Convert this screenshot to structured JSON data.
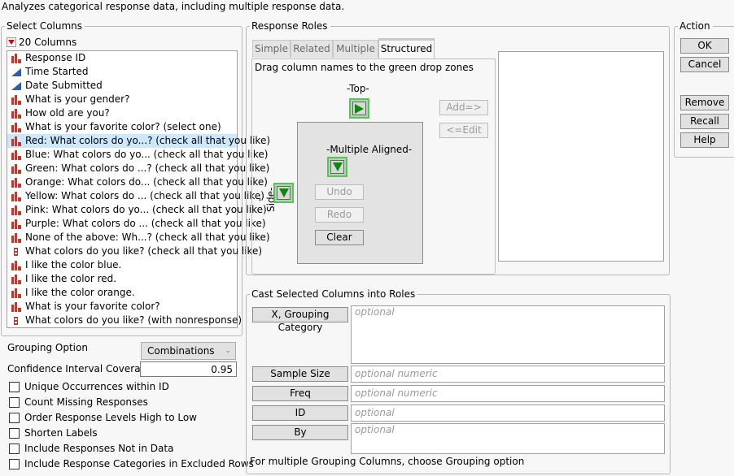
{
  "description": "Analyzes categorical response data, including multiple response data.",
  "select_columns": {
    "title": "Select Columns",
    "count_label": "20 Columns",
    "columns": [
      {
        "label": "Response ID",
        "type": "nominal"
      },
      {
        "label": "Time Started",
        "type": "continuous"
      },
      {
        "label": "Date Submitted",
        "type": "continuous"
      },
      {
        "label": "What is your gender?",
        "type": "nominal"
      },
      {
        "label": "How old are you?",
        "type": "nominal"
      },
      {
        "label": "What is your favorite color? (select one)",
        "type": "nominal"
      },
      {
        "label": "Red: What colors do yo...? (check all that you like)",
        "type": "nominal",
        "selected": true
      },
      {
        "label": "Blue: What colors do yo... (check all that you like)",
        "type": "nominal"
      },
      {
        "label": "Green: What colors do ...? (check all that you like)",
        "type": "nominal"
      },
      {
        "label": "Orange: What colors do... (check all that you like)",
        "type": "nominal"
      },
      {
        "label": "Yellow: What colors do ... (check all that you like)",
        "type": "nominal"
      },
      {
        "label": "Pink: What colors do yo... (check all that you like)",
        "type": "nominal"
      },
      {
        "label": "Purple: What colors do ... (check all that you like)",
        "type": "nominal"
      },
      {
        "label": "None of the above: Wh...? (check all that you like)",
        "type": "nominal"
      },
      {
        "label": "What colors do you like? (check all that you like)",
        "type": "multiple-response"
      },
      {
        "label": "I like the color blue.",
        "type": "nominal"
      },
      {
        "label": "I like the color red.",
        "type": "nominal"
      },
      {
        "label": "I like the color orange.",
        "type": "nominal"
      },
      {
        "label": "What is your favorite color?",
        "type": "nominal"
      },
      {
        "label": "What colors do you like? (with nonresponse)",
        "type": "multiple-response"
      }
    ]
  },
  "options": {
    "grouping_label": "Grouping Option",
    "grouping_value": "Combinations",
    "ci_label": "Confidence Interval Coverage",
    "ci_value": "0.95",
    "checkboxes": [
      {
        "label": "Unique Occurrences within ID",
        "checked": false
      },
      {
        "label": "Count Missing Responses",
        "checked": false
      },
      {
        "label": "Order Response Levels High to Low",
        "checked": false
      },
      {
        "label": "Shorten Labels",
        "checked": false
      },
      {
        "label": "Include Responses Not in Data",
        "checked": false
      },
      {
        "label": "Include Response Categories in Excluded Rows",
        "checked": false
      }
    ]
  },
  "response_roles": {
    "title": "Response Roles",
    "tabs": [
      "Simple",
      "Related",
      "Multiple",
      "Structured"
    ],
    "active_tab": "Structured",
    "instruction": "Drag column names to the green drop zones",
    "top_label": "-Top-",
    "side_label": "-Side-",
    "multiple_aligned_label": "-Multiple Aligned-",
    "undo": "Undo",
    "redo": "Redo",
    "clear": "Clear",
    "add": "Add=>",
    "edit": "<=Edit"
  },
  "cast": {
    "title": "Cast Selected Columns into Roles",
    "roles": [
      {
        "label": "X, Grouping Category",
        "placeholder": "optional"
      },
      {
        "label": "Sample Size",
        "placeholder": "optional numeric"
      },
      {
        "label": "Freq",
        "placeholder": "optional numeric"
      },
      {
        "label": "ID",
        "placeholder": "optional"
      },
      {
        "label": "By",
        "placeholder": "optional"
      }
    ],
    "footer": "For multiple Grouping Columns, choose Grouping option"
  },
  "action": {
    "title": "Action",
    "ok": "OK",
    "cancel": "Cancel",
    "remove": "Remove",
    "recall": "Recall",
    "help": "Help"
  },
  "colors": {
    "nominal_icon": "#c0392b",
    "continuous_icon": "#2a5db0",
    "selection": "#cce8ff",
    "dropzone": "#0a8a0a"
  }
}
